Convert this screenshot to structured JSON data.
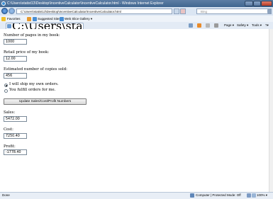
{
  "window": {
    "title": "C:\\Users\\statist13\\Desktop\\IncentiveCalculator\\IncentiveCalculator.html - Windows Internet Explorer"
  },
  "address": {
    "url": "C:\\Users\\statist13\\Desktop\\IncentiveCalculator\\IncentiveCalculator.html",
    "search_placeholder": "Bing"
  },
  "favorites": {
    "label": "Favorites",
    "items": [
      "Suggested Sites ▾",
      "Web Slice Gallery ▾"
    ]
  },
  "tab": {
    "label": "C:\\Users\\statist13\\Desktop\\IncentiveCalculator\\Incen..."
  },
  "command_bar": {
    "page": "Page ▾",
    "safety": "Safety ▾",
    "tools": "Tools ▾",
    "help": "?▾"
  },
  "form": {
    "pages_label": "Number of pages in my book:",
    "pages_value": "1000",
    "price_label": "Retail price of my book:",
    "price_value": "12.00",
    "copies_label": "Estimated number of copies sold:",
    "copies_value": "456",
    "ship_own_label": "I will ship my own orders.",
    "fulfill_label": "You fulfill orders for me.",
    "update_button": "Update Sales/Cost/Profit Numbers",
    "sales_label": "Sales:",
    "sales_value": "5472.00",
    "cost_label": "Cost:",
    "cost_value": "7250.40",
    "profit_label": "Profit:",
    "profit_value": "-1778.40"
  },
  "selected_option": "ship_own",
  "status": {
    "left": "Done",
    "zone": "Computer | Protected Mode: Off",
    "zoom": "100% ▾"
  },
  "colors": {
    "titlebar": "#3f6690",
    "chrome": "#dbe6f3",
    "page": "#ffffff"
  }
}
